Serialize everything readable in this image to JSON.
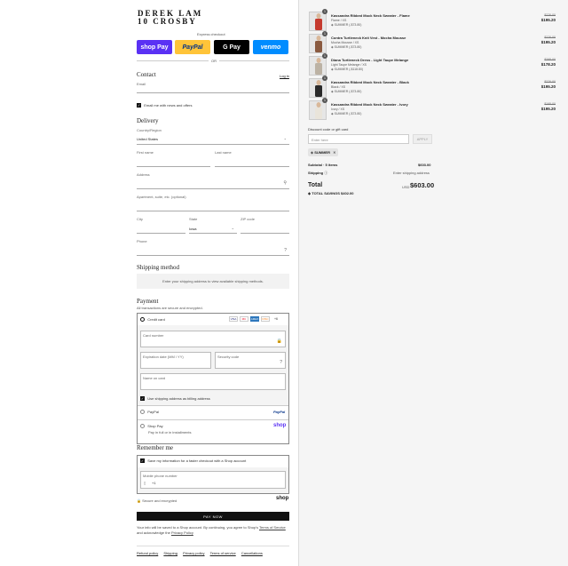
{
  "brand": {
    "line1": "DEREK LAM",
    "line2": "10 CROSBY"
  },
  "express": {
    "label": "Express checkout",
    "shop": "shop Pay",
    "paypal": "PayPal",
    "gpay": "G Pay",
    "venmo": "venmo",
    "or": "OR"
  },
  "contact": {
    "title": "Contact",
    "login": "Log in",
    "email_label": "Email",
    "news_label": "Email me with news and offers"
  },
  "delivery": {
    "title": "Delivery",
    "country_label": "Country/Region",
    "country_value": "United States",
    "first_name": "First name",
    "last_name": "Last name",
    "address": "Address",
    "apt": "Apartment, suite, etc. (optional)",
    "city": "City",
    "state_label": "State",
    "state_value": "Iowa",
    "zip": "ZIP code",
    "phone": "Phone"
  },
  "shipping": {
    "title": "Shipping method",
    "note": "Enter your shipping address to view available shipping methods."
  },
  "payment": {
    "title": "Payment",
    "subtitle": "All transactions are secure and encrypted.",
    "credit_card": "Credit card",
    "card_icons": [
      "VISA",
      "MC",
      "AMEX",
      "DISC",
      "+6"
    ],
    "card_number": "Card number",
    "expiry": "Expiration date (MM / YY)",
    "security": "Security code",
    "name_on_card": "Name on card",
    "billing_same": "Use shipping address as billing address",
    "paypal": "PayPal",
    "paypal_logo": "PayPal",
    "shoppay": "Shop Pay",
    "shoppay_sub": "Pay in full or in installments",
    "shoppay_logo": "shop"
  },
  "remember": {
    "title": "Remember me",
    "save_info": "Save my information for a faster checkout with a Shop account",
    "mobile_label": "Mobile phone number",
    "mobile_prefix": "+1",
    "secure": "Secure and encrypted",
    "shop_logo": "shop"
  },
  "pay_now": "PAY NOW",
  "terms": {
    "text": "Your info will be saved to a Shop account. By continuing, you agree to Shop's",
    "terms_link": "Terms of Service",
    "and": "and acknowledge the",
    "privacy_link": "Privacy Policy"
  },
  "footer": [
    "Refund policy",
    "Shipping",
    "Privacy policy",
    "Terms of service",
    "Cancellations"
  ],
  "cart": {
    "items": [
      {
        "qty": "1",
        "name": "Kassandra Ribbed Mock Neck Sweater - Flame",
        "variant": "Flame / XS",
        "discount": "SUMMER (-$73.80)",
        "old": "$276.00",
        "new": "$195.20",
        "color": "#c53a2e"
      },
      {
        "qty": "1",
        "name": "Contra Turtleneck Knit Vest - Mocha Mousse",
        "variant": "Mocha Mousse / XS",
        "discount": "SUMMER (-$73.80)",
        "old": "$276.00",
        "new": "$195.20",
        "color": "#8a5a40"
      },
      {
        "qty": "1",
        "name": "Diana Turtleneck Dress - Light Taupe Melange",
        "variant": "Light Taupe Melange / XS",
        "discount": "SUMMER (-$118.80)",
        "old": "$295.00",
        "new": "$178.20",
        "color": "#bcb2a4"
      },
      {
        "qty": "1",
        "name": "Kassandra Ribbed Mock Neck Sweater - Black",
        "variant": "Black / XS",
        "discount": "SUMMER (-$73.80)",
        "old": "$276.00",
        "new": "$195.20",
        "color": "#2a2a2a"
      },
      {
        "qty": "1",
        "name": "Kassandra Ribbed Mock Neck Sweater - Ivory",
        "variant": "Ivory / XS",
        "discount": "SUMMER (-$73.80)",
        "old": "$195.00",
        "new": "$195.20",
        "color": "#e9e4da"
      }
    ],
    "discount_label": "Discount code or gift card",
    "discount_placeholder": "Enter here",
    "apply": "APPLY",
    "applied_code": "SUMMER",
    "subtotal_label": "Subtotal · 5 items",
    "subtotal_value": "$603.00",
    "shipping_label": "Shipping",
    "shipping_value": "Enter shipping address",
    "total_label": "Total",
    "currency": "USD",
    "total_value": "$603.00",
    "savings": "TOTAL SAVINGS $402.00"
  }
}
